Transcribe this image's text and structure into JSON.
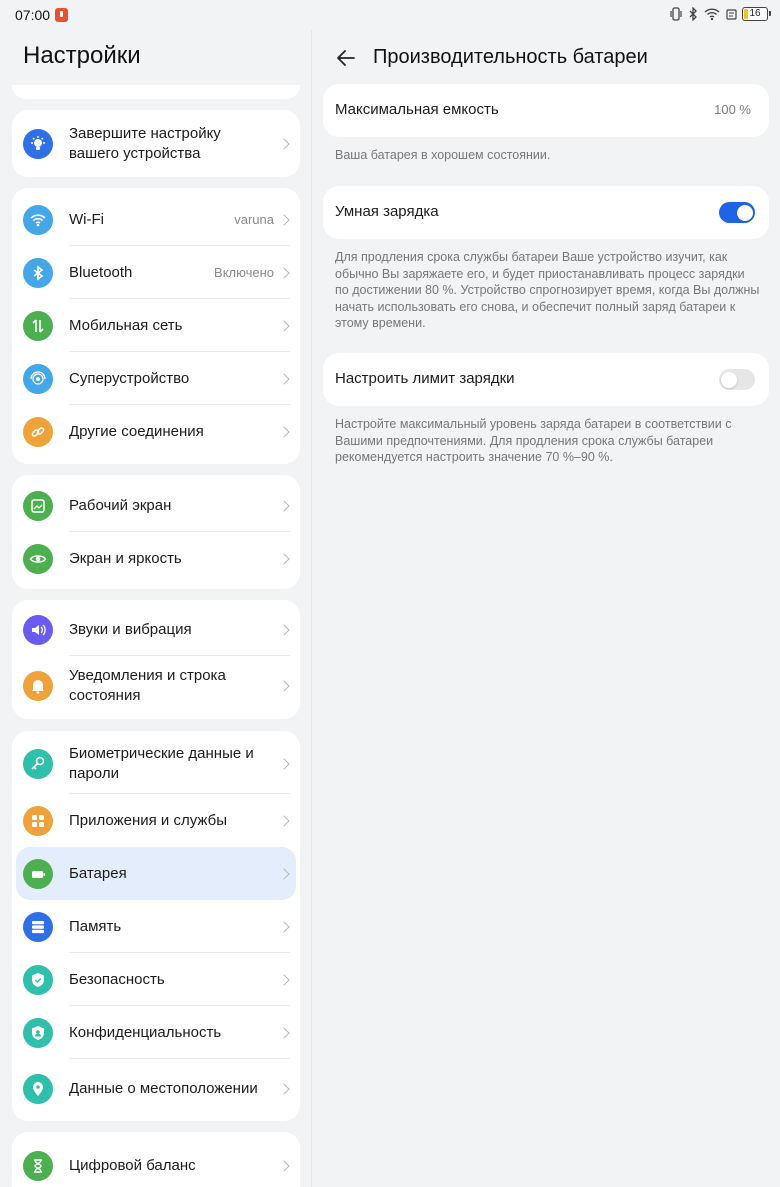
{
  "status_bar": {
    "time": "07:00",
    "battery_level": "16",
    "battery_fraction": 0.16
  },
  "left": {
    "title": "Настройки",
    "setup_card": {
      "label": "Завершите настройку вашего устройства"
    },
    "connectivity": [
      {
        "label": "Wi-Fi",
        "value": "varuna",
        "icon": "wifi-icon",
        "color": "#43a7e8"
      },
      {
        "label": "Bluetooth",
        "value": "Включено",
        "icon": "bluetooth-icon",
        "color": "#43a7e8"
      },
      {
        "label": "Мобильная сеть",
        "value": "",
        "icon": "mobile-network-icon",
        "color": "#4caf50"
      },
      {
        "label": "Суперустройство",
        "value": "",
        "icon": "superdevice-icon",
        "color": "#43a7e8"
      },
      {
        "label": "Другие соединения",
        "value": "",
        "icon": "link-icon",
        "color": "#f0a23a"
      }
    ],
    "display": [
      {
        "label": "Рабочий экран",
        "icon": "home-screen-icon",
        "color": "#4caf50"
      },
      {
        "label": "Экран и яркость",
        "icon": "eye-icon",
        "color": "#4caf50"
      }
    ],
    "sound": [
      {
        "label": "Звуки и вибрация",
        "icon": "sound-icon",
        "color": "#6a5cf0"
      },
      {
        "label": "Уведомления и строка состояния",
        "icon": "bell-icon",
        "color": "#f0a23a"
      }
    ],
    "system": [
      {
        "label": "Биометрические данные и пароли",
        "icon": "key-icon",
        "color": "#2fbfaa"
      },
      {
        "label": "Приложения и службы",
        "icon": "apps-icon",
        "color": "#f0a23a"
      },
      {
        "label": "Батарея",
        "icon": "battery-icon",
        "color": "#4caf50",
        "selected": true
      },
      {
        "label": "Память",
        "icon": "storage-icon",
        "color": "#2f6fe8"
      },
      {
        "label": "Безопасность",
        "icon": "shield-icon",
        "color": "#2fbfaa"
      },
      {
        "label": "Конфиденциальность",
        "icon": "privacy-icon",
        "color": "#2fbfaa"
      },
      {
        "label": "Данные о местоположении",
        "icon": "location-icon",
        "color": "#2fbfaa"
      }
    ],
    "wellbeing": [
      {
        "label": "Цифровой баланс",
        "icon": "hourglass-icon",
        "color": "#4caf50"
      }
    ]
  },
  "right": {
    "title": "Производительность батареи",
    "max_capacity": {
      "label": "Максимальная емкость",
      "value": "100 %"
    },
    "health_note": "Ваша батарея в хорошем состоянии.",
    "smart_charging": {
      "label": "Умная зарядка",
      "enabled": true
    },
    "smart_charging_note": "Для продления срока службы батареи Ваше устройство изучит, как обычно Вы заряжаете его, и будет приостанавливать процесс зарядки по достижении 80 %. Устройство спрогнозирует время, когда Вы должны начать использовать его снова, и обеспечит полный заряд батареи к этому времени.",
    "charge_limit": {
      "label": "Настроить лимит зарядки",
      "enabled": false
    },
    "charge_limit_note": "Настройте максимальный уровень заряда батареи в соответствии с Вашими предпочтениями. Для продления срока службы батареи рекомендуется настроить значение 70 %–90 %."
  }
}
